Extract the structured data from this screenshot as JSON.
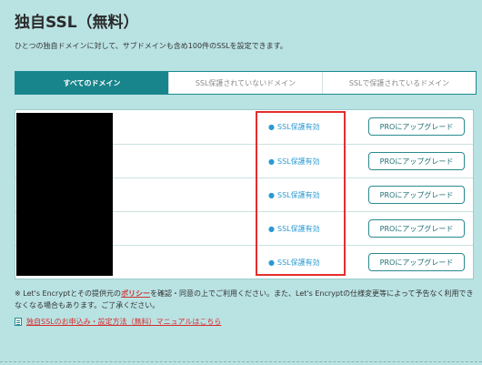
{
  "page": {
    "title": "独自SSL（無料）",
    "subtitle": "ひとつの独自ドメインに対して、サブドメインも含め100件のSSLを設定できます。"
  },
  "tabs": [
    {
      "label": "すべてのドメイン",
      "active": true
    },
    {
      "label": "SSL保護されていないドメイン",
      "active": false
    },
    {
      "label": "SSLで保護されているドメイン",
      "active": false
    }
  ],
  "domains": [
    {
      "status": "SSL保護有効",
      "button": "PROにアップグレード"
    },
    {
      "status": "SSL保護有効",
      "button": "PROにアップグレード"
    },
    {
      "status": "SSL保護有効",
      "button": "PROにアップグレード"
    },
    {
      "status": "SSL保護有効",
      "button": "PROにアップグレード"
    },
    {
      "status": "SSL保護有効",
      "button": "PROにアップグレード"
    }
  ],
  "note": {
    "prefix": "※ Let's Encryptとその提供元の",
    "policy_link": "ポリシー",
    "suffix": "を確認・同意の上でご利用ください。また、Let's Encryptの仕様変更等によって予告なく利用できなくなる場合もあります。ご了承ください。"
  },
  "manual_link": "独自SSLのお申込み・設定方法（無料）マニュアルはこちら",
  "colors": {
    "background": "#b9e2e3",
    "tab_active": "#17858b",
    "status_text": "#2a9ad2",
    "highlight_border": "#e52d2d",
    "link_red": "#d62d2d"
  }
}
